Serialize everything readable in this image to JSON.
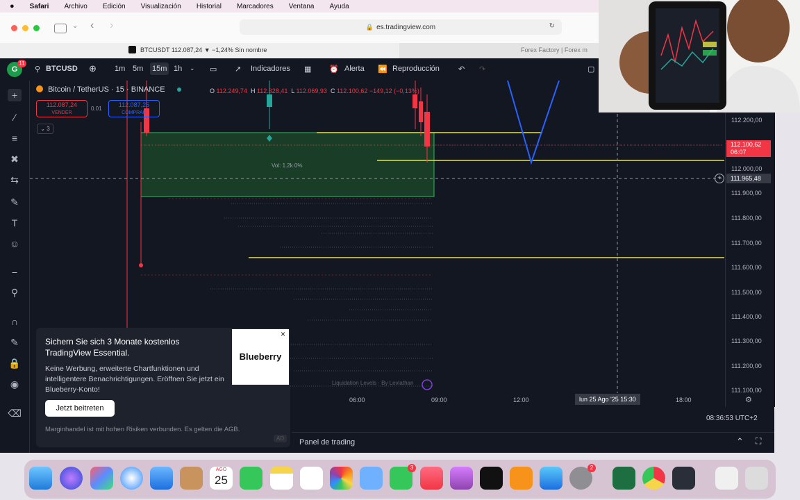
{
  "menubar": {
    "apple": "",
    "items": [
      "Safari",
      "Archivo",
      "Edición",
      "Visualización",
      "Historial",
      "Marcadores",
      "Ventana",
      "Ayuda"
    ]
  },
  "safari": {
    "url": "es.tradingview.com",
    "tab_active": "BTCUSDT 112.087,24 ▼ −1,24% Sin nombre",
    "tab_other": "Forex Factory | Forex m"
  },
  "tv": {
    "avatar_initial": "G",
    "avatar_badge": "11",
    "symbol": "BTCUSD",
    "timeframes": [
      "1m",
      "5m",
      "15m",
      "1h"
    ],
    "active_timeframe": "15m",
    "indicators_label": "Indicadores",
    "alert_label": "Alerta",
    "replay_label": "Reproducción",
    "legend_title": "Bitcoin / TetherUS · 15 · BINANCE",
    "ohlc": {
      "o_label": "O",
      "o": "112.249,74",
      "h_label": "H",
      "h": "112.328,41",
      "l_label": "L",
      "l": "112.069,93",
      "c_label": "C",
      "c": "112.100,62",
      "change": "−149,12 (−0,13%)"
    },
    "sell_price": "112.087,24",
    "sell_label": "VENDER",
    "spread": "0.01",
    "buy_price": "112.087,25",
    "buy_label": "COMPRAR",
    "indicator_count": "3",
    "box_label": "Vol: 1.2k  0%",
    "price_labels": [
      "112.200,00",
      "112.000,00",
      "111.900,00",
      "111.800,00",
      "111.700,00",
      "111.600,00",
      "111.500,00",
      "111.400,00",
      "111.300,00",
      "111.200,00",
      "111.100,00"
    ],
    "current_price": "112.100,62",
    "current_countdown": "06:07",
    "crosshair_price": "111.965,48",
    "time_labels": [
      "06:00",
      "09:00",
      "12:00",
      "18:00"
    ],
    "crosshair_time": "lun 25 Ago '25   15:30",
    "watermark": "Liquidation Levels · By Leviathan",
    "clock": "08:36:53 UTC+2",
    "panel_label": "Panel de trading",
    "colors": {
      "up": "#26a69a",
      "down": "#f23645",
      "yellow": "#e6e34a",
      "zone": "#1f5c2a",
      "blue": "#2962ff"
    }
  },
  "promo": {
    "title": "Sichern Sie sich 3 Monate kostenlos TradingView Essential.",
    "body": "Keine Werbung, erweiterte Chartfunktionen und intelligentere Benachrichtigungen. Eröffnen Sie jetzt ein Blueberry-Konto!",
    "button": "Jetzt beitreten",
    "disclaimer": "Marginhandel ist mit hohen Risiken verbunden. Es gelten die AGB.",
    "brand": "Blueberry",
    "ad_badge": "AD",
    "close": "×"
  },
  "dock": {
    "calendar_month": "AGO",
    "calendar_day": "25",
    "badges": {
      "facetime": "3",
      "settings": "2"
    }
  }
}
